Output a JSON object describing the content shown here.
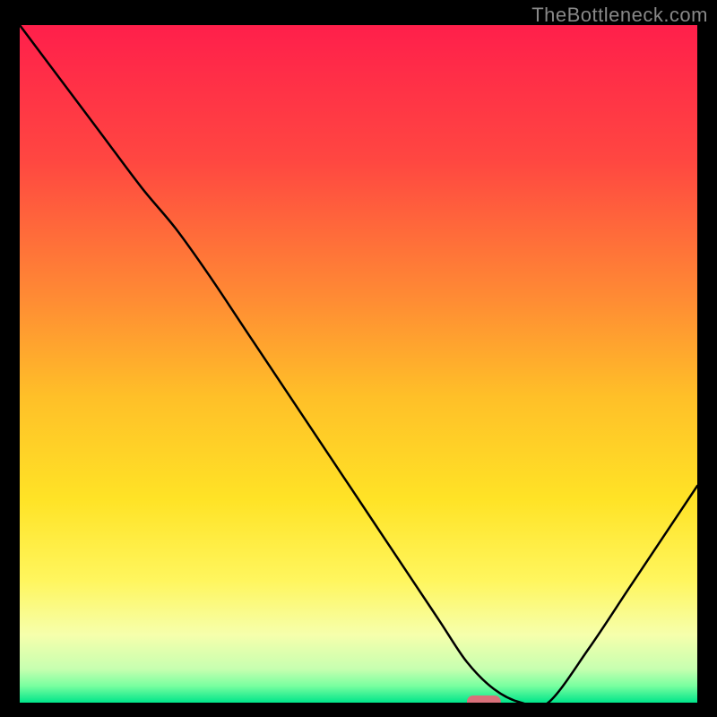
{
  "watermark": "TheBottleneck.com",
  "chart_data": {
    "type": "line",
    "title": "",
    "xlabel": "",
    "ylabel": "",
    "xlim": [
      0,
      100
    ],
    "ylim": [
      0,
      100
    ],
    "x": [
      0,
      6,
      12,
      18,
      23,
      28,
      34,
      40,
      46,
      52,
      58,
      62,
      66,
      70,
      74,
      78,
      84,
      90,
      96,
      100
    ],
    "values": [
      100,
      92,
      84,
      76,
      70,
      63,
      54,
      45,
      36,
      27,
      18,
      12,
      6,
      2,
      0,
      0,
      8,
      17,
      26,
      32
    ],
    "marker": {
      "x_range": [
        66,
        71
      ],
      "y": 0
    },
    "background": {
      "type": "vertical_gradient",
      "stops": [
        {
          "pos": 0.0,
          "color": "#ff1f4b"
        },
        {
          "pos": 0.2,
          "color": "#ff4741"
        },
        {
          "pos": 0.4,
          "color": "#ff8a34"
        },
        {
          "pos": 0.55,
          "color": "#ffc028"
        },
        {
          "pos": 0.7,
          "color": "#ffe326"
        },
        {
          "pos": 0.82,
          "color": "#fff65e"
        },
        {
          "pos": 0.9,
          "color": "#f6ffac"
        },
        {
          "pos": 0.95,
          "color": "#c7ffb0"
        },
        {
          "pos": 0.975,
          "color": "#7affa0"
        },
        {
          "pos": 1.0,
          "color": "#00e58a"
        }
      ]
    }
  }
}
